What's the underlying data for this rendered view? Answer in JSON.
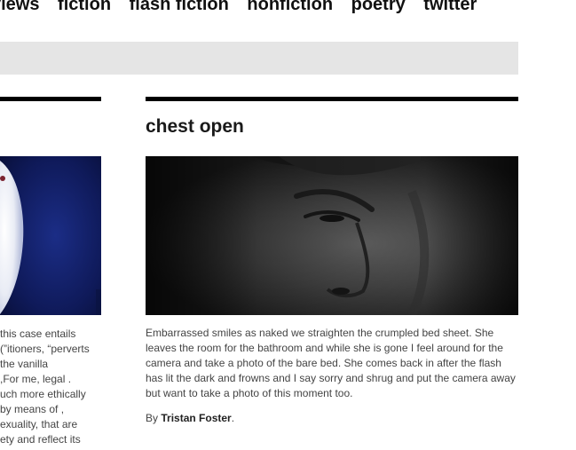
{
  "nav": {
    "items": [
      "views",
      "fiction",
      "flash fiction",
      "nonfiction",
      "poetry",
      "twitter"
    ]
  },
  "left_column": {
    "excerpt_lines": [
      "this case entails",
      "itioners, “perverts”)",
      "the vanilla",
      ". For me, legal,",
      "uch more ethically",
      ", by means of",
      "exuality, that are",
      "ety and reflect its"
    ]
  },
  "post": {
    "title": "chest open",
    "excerpt": "Embarrassed smiles as naked we straighten the crumpled bed sheet. She leaves the room for the bathroom and while she is gone I feel around for the camera and take a photo of the bare bed. She comes back in after the flash has lit the dark and frowns and I say sorry and shrug and put the camera away but want to take a photo of this moment too.",
    "byline_prefix": "By",
    "author": "Tristan Foster",
    "byline_suffix": "."
  },
  "colors": {
    "rule": "#000000",
    "graybar": "#e5e5e5",
    "left_image": "#0f1a55",
    "photo": "#2a2a2a"
  }
}
